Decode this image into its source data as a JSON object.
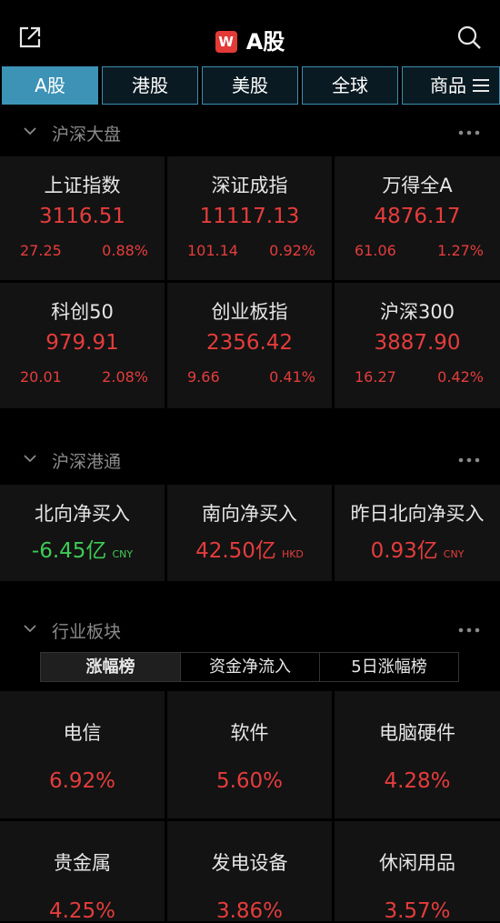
{
  "header": {
    "title": "A股",
    "logo_letter": "W"
  },
  "tabs": [
    "A股",
    "港股",
    "美股",
    "全球",
    "商品"
  ],
  "sections": {
    "market": "沪深大盘",
    "connect": "沪深港通",
    "industry": "行业板块"
  },
  "indices": [
    {
      "name": "上证指数",
      "value": "3116.51",
      "change": "27.25",
      "pct": "0.88%"
    },
    {
      "name": "深证成指",
      "value": "11117.13",
      "change": "101.14",
      "pct": "0.92%"
    },
    {
      "name": "万得全A",
      "value": "4876.17",
      "change": "61.06",
      "pct": "1.27%"
    },
    {
      "name": "科创50",
      "value": "979.91",
      "change": "20.01",
      "pct": "2.08%"
    },
    {
      "name": "创业板指",
      "value": "2356.42",
      "change": "9.66",
      "pct": "0.41%"
    },
    {
      "name": "沪深300",
      "value": "3887.90",
      "change": "16.27",
      "pct": "0.42%"
    }
  ],
  "flows": [
    {
      "name": "北向净买入",
      "value": "-6.45亿",
      "unit": "CNY"
    },
    {
      "name": "南向净买入",
      "value": "42.50亿",
      "unit": "HKD"
    },
    {
      "name": "昨日北向净买入",
      "value": "0.93亿",
      "unit": "CNY"
    }
  ],
  "industry_tabs": [
    "涨幅榜",
    "资金净流入",
    "5日涨幅榜"
  ],
  "industries": [
    {
      "name": "电信",
      "pct": "6.92%"
    },
    {
      "name": "软件",
      "pct": "5.60%"
    },
    {
      "name": "电脑硬件",
      "pct": "4.28%"
    },
    {
      "name": "贵金属",
      "pct": "4.25%"
    },
    {
      "name": "发电设备",
      "pct": "3.86%"
    },
    {
      "name": "休闲用品",
      "pct": "3.57%"
    }
  ],
  "colors": {
    "up": "#e53c3c",
    "down": "#3ecb55",
    "tab_active": "#3d93b6"
  }
}
